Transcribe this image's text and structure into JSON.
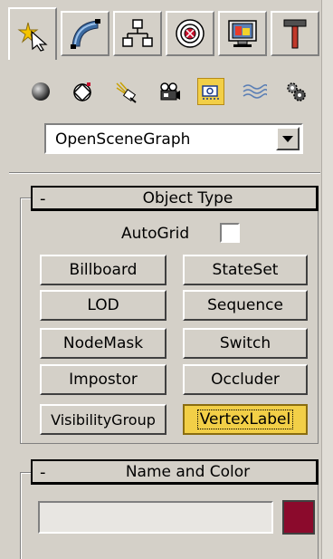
{
  "tabs": [
    {
      "icon": "create-cursor-icon",
      "active": true
    },
    {
      "icon": "modify-arc-icon",
      "active": false
    },
    {
      "icon": "hierarchy-icon",
      "active": false
    },
    {
      "icon": "motion-target-icon",
      "active": false
    },
    {
      "icon": "display-monitor-icon",
      "active": false
    },
    {
      "icon": "utilities-hammer-icon",
      "active": false
    }
  ],
  "categories": [
    {
      "icon": "geometry-sphere-icon",
      "active": false
    },
    {
      "icon": "shapes-icon",
      "active": false
    },
    {
      "icon": "lights-icon",
      "active": false
    },
    {
      "icon": "cameras-icon",
      "active": false
    },
    {
      "icon": "helpers-icon",
      "active": true
    },
    {
      "icon": "space-warps-icon",
      "active": false
    },
    {
      "icon": "systems-icon",
      "active": false
    }
  ],
  "dropdown": {
    "value": "OpenSceneGraph"
  },
  "object_type": {
    "collapse_symbol": "-",
    "title": "Object Type",
    "autogrid_label": "AutoGrid",
    "autogrid_checked": false,
    "buttons": [
      "Billboard",
      "StateSet",
      "LOD",
      "Sequence",
      "NodeMask",
      "Switch",
      "Impostor",
      "Occluder",
      "VisibilityGroup",
      "VertexLabel"
    ],
    "selected": "VertexLabel"
  },
  "name_and_color": {
    "collapse_symbol": "-",
    "title": "Name and Color",
    "name_value": "",
    "color": "#8b0a2c"
  },
  "colors": {
    "panel": "#d4d0c8",
    "highlight": "#f2cf47"
  }
}
